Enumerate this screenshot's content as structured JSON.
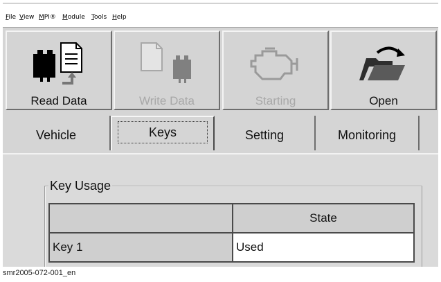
{
  "menu": [
    "File",
    "View",
    "MPI®",
    "Module",
    "Tools",
    "Help"
  ],
  "toolbar": {
    "read_label": "Read Data",
    "write_label": "Write Data",
    "starting_label": "Starting",
    "open_label": "Open"
  },
  "tabs": [
    {
      "label": "Vehicle",
      "active": false
    },
    {
      "label": "Keys",
      "active": true
    },
    {
      "label": "Setting",
      "active": false
    },
    {
      "label": "Monitoring",
      "active": false
    }
  ],
  "key_usage": {
    "title": "Key Usage",
    "header_state": "State",
    "rows": [
      {
        "key": "Key 1",
        "state": "Used"
      }
    ]
  },
  "caption": "smr2005-072-001_en"
}
